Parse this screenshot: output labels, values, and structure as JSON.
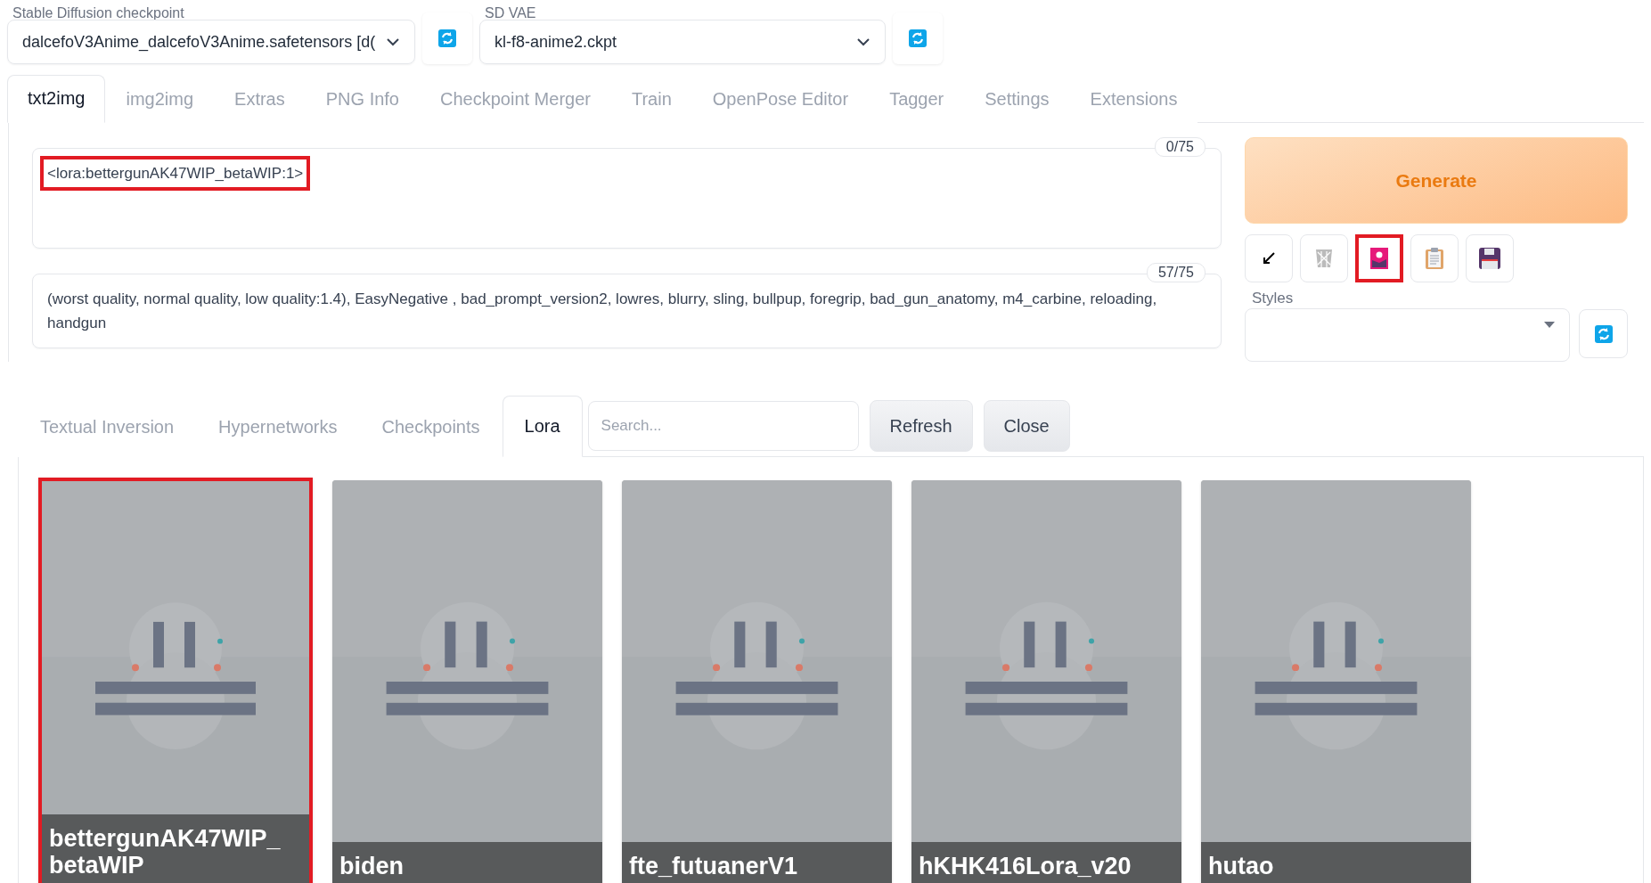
{
  "checkpoint": {
    "label": "Stable Diffusion checkpoint",
    "value": "dalcefoV3Anime_dalcefoV3Anime.safetensors [d("
  },
  "vae": {
    "label": "SD VAE",
    "value": "kl-f8-anime2.ckpt"
  },
  "tabs": [
    {
      "label": "txt2img",
      "selected": true
    },
    {
      "label": "img2img",
      "selected": false
    },
    {
      "label": "Extras",
      "selected": false
    },
    {
      "label": "PNG Info",
      "selected": false
    },
    {
      "label": "Checkpoint Merger",
      "selected": false
    },
    {
      "label": "Train",
      "selected": false
    },
    {
      "label": "OpenPose Editor",
      "selected": false
    },
    {
      "label": "Tagger",
      "selected": false
    },
    {
      "label": "Settings",
      "selected": false
    },
    {
      "label": "Extensions",
      "selected": false
    }
  ],
  "prompt": {
    "value": "<lora:bettergunAK47WIP_betaWIP:1>",
    "counter": "0/75",
    "highlighted": true
  },
  "negative_prompt": {
    "value": "(worst quality, normal quality, low quality:1.4), EasyNegative , bad_prompt_version2, lowres, blurry, sling, bullpup, foregrip, bad_gun_anatomy, m4_carbine, reloading, handgun",
    "counter": "57/75",
    "highlighted": false
  },
  "generate_button": "Generate",
  "tool_buttons": [
    {
      "kind": "arrow",
      "highlighted": false
    },
    {
      "kind": "trash",
      "highlighted": false
    },
    {
      "kind": "picture",
      "highlighted": true
    },
    {
      "kind": "clipboard",
      "highlighted": false
    },
    {
      "kind": "save",
      "highlighted": false
    }
  ],
  "styles": {
    "label": "Styles"
  },
  "extra_tabs": [
    {
      "label": "Textual Inversion",
      "selected": false
    },
    {
      "label": "Hypernetworks",
      "selected": false
    },
    {
      "label": "Checkpoints",
      "selected": false
    },
    {
      "label": "Lora",
      "selected": true
    }
  ],
  "search": {
    "placeholder": "Search..."
  },
  "extra_buttons": [
    "Refresh",
    "Close"
  ],
  "cards": [
    {
      "name": "bettergunAK47WIP_ betaWIP",
      "highlighted": true
    },
    {
      "name": "biden",
      "highlighted": false
    },
    {
      "name": "fte_futuanerV1",
      "highlighted": false
    },
    {
      "name": "hKHK416Lora_v20",
      "highlighted": false
    },
    {
      "name": "hutao",
      "highlighted": false
    }
  ]
}
